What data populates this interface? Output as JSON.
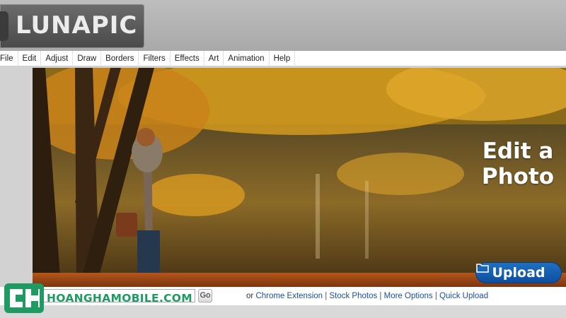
{
  "app": {
    "logo_text": "LUNAPIC"
  },
  "menu": {
    "items": [
      {
        "label": "File"
      },
      {
        "label": "Edit"
      },
      {
        "label": "Adjust"
      },
      {
        "label": "Draw"
      },
      {
        "label": "Borders"
      },
      {
        "label": "Filters"
      },
      {
        "label": "Effects"
      },
      {
        "label": "Art"
      },
      {
        "label": "Animation"
      },
      {
        "label": "Help"
      }
    ]
  },
  "hero": {
    "title_line1": "Edit a",
    "title_line2": "Photo",
    "upload_label": "Upload",
    "upload_icon": "folder-icon"
  },
  "bottom": {
    "go_label": "Go",
    "prefix": "or",
    "links": [
      {
        "label": "Chrome Extension"
      },
      {
        "label": "Stock Photos"
      },
      {
        "label": "More Options"
      },
      {
        "label": "Quick Upload"
      }
    ]
  },
  "watermark": {
    "text": "HOANGHAMOBILE.COM"
  },
  "colors": {
    "accent": "#1f6fc2",
    "link": "#1b4fa0",
    "watermark": "#1e9a62"
  }
}
